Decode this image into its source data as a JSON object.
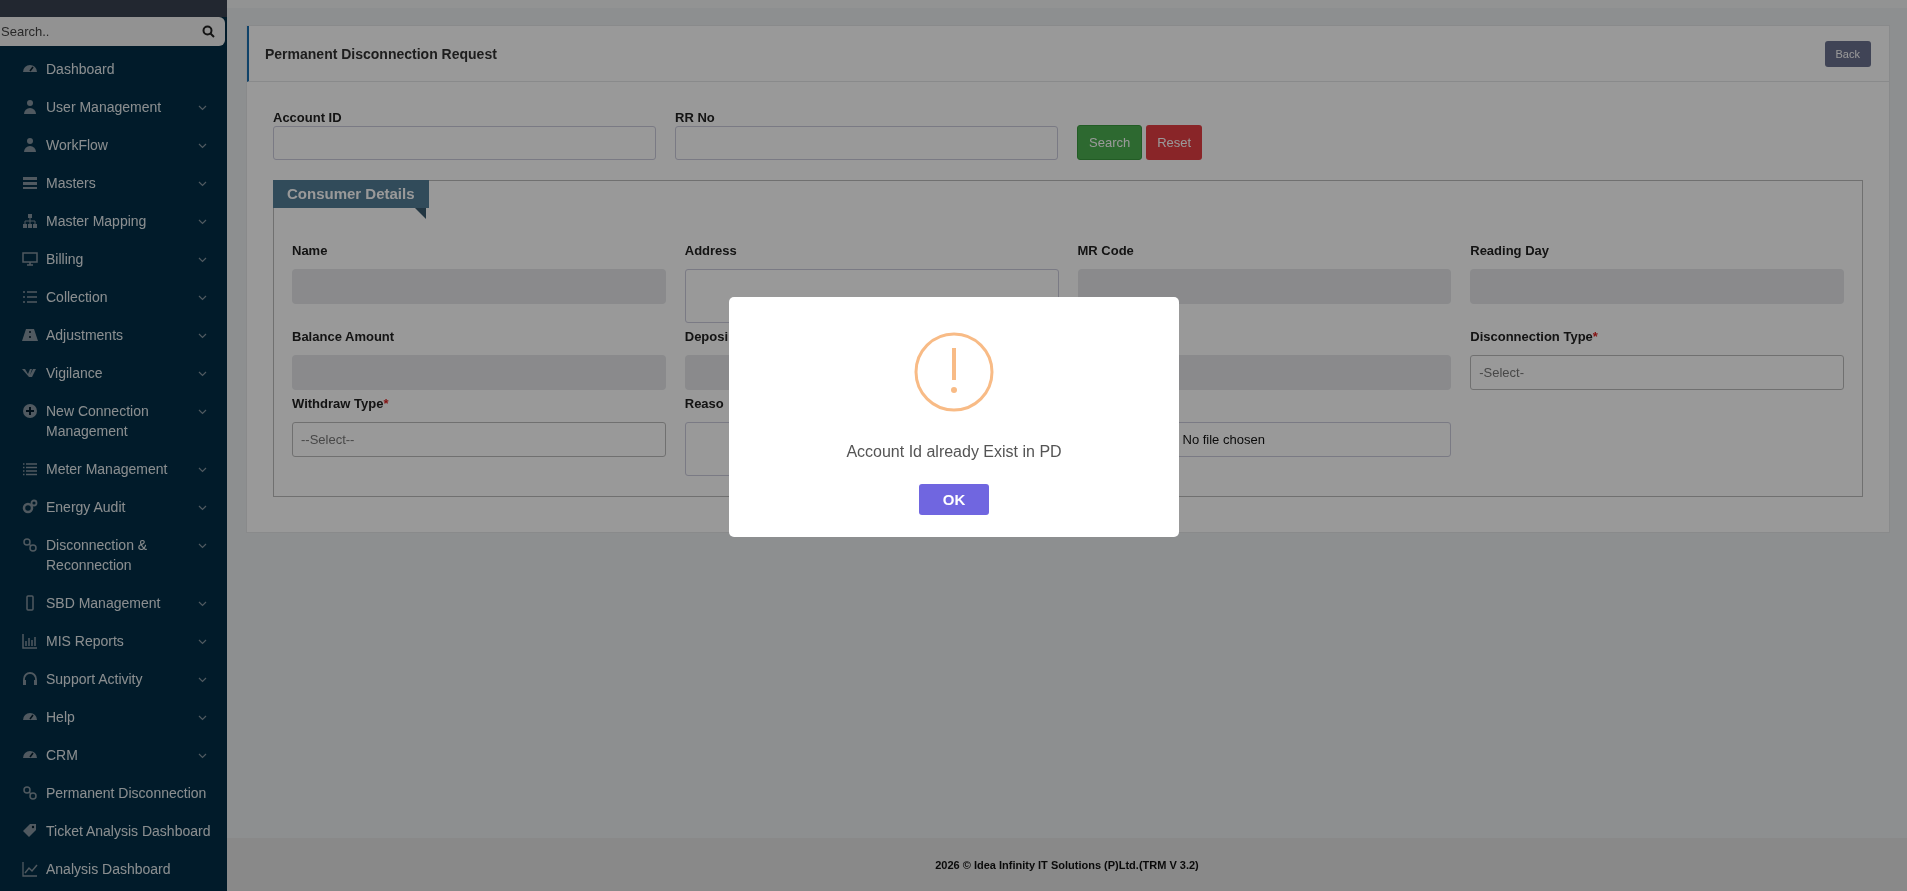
{
  "sidebar": {
    "search_placeholder": "Search..",
    "items": [
      {
        "label": "Dashboard",
        "has_submenu": false
      },
      {
        "label": "User Management",
        "has_submenu": true
      },
      {
        "label": "WorkFlow",
        "has_submenu": true
      },
      {
        "label": "Masters",
        "has_submenu": true
      },
      {
        "label": "Master Mapping",
        "has_submenu": true
      },
      {
        "label": "Billing",
        "has_submenu": true
      },
      {
        "label": "Collection",
        "has_submenu": true
      },
      {
        "label": "Adjustments",
        "has_submenu": true
      },
      {
        "label": "Vigilance",
        "has_submenu": true
      },
      {
        "label": "New Connection Management",
        "has_submenu": true
      },
      {
        "label": "Meter Management",
        "has_submenu": true
      },
      {
        "label": "Energy Audit",
        "has_submenu": true
      },
      {
        "label": "Disconnection & Reconnection",
        "has_submenu": true
      },
      {
        "label": "SBD Management",
        "has_submenu": true
      },
      {
        "label": "MIS Reports",
        "has_submenu": true
      },
      {
        "label": "Support Activity",
        "has_submenu": true
      },
      {
        "label": "Help",
        "has_submenu": true
      },
      {
        "label": "CRM",
        "has_submenu": true
      },
      {
        "label": "Permanent Disconnection",
        "has_submenu": false
      },
      {
        "label": "Ticket Analysis Dashboard",
        "has_submenu": false
      },
      {
        "label": "Analysis Dashboard",
        "has_submenu": false
      }
    ]
  },
  "page": {
    "title": "Permanent Disconnection Request",
    "back_button": "Back",
    "search_form": {
      "fields": [
        {
          "label": "Account ID"
        },
        {
          "label": "RR No"
        }
      ],
      "buttons": [
        {
          "label": "Search",
          "kind": "success"
        },
        {
          "label": "Reset",
          "kind": "danger"
        }
      ]
    },
    "consumer_details": {
      "title": "Consumer Details",
      "fields": [
        {
          "label": "Name",
          "kind": "readonly"
        },
        {
          "label": "Address",
          "kind": "textarea"
        },
        {
          "label": "MR Code",
          "kind": "readonly"
        },
        {
          "label": "Reading Day",
          "kind": "readonly"
        },
        {
          "label": "Balance Amount",
          "kind": "readonly"
        },
        {
          "label": "Deposi",
          "kind": "readonly"
        },
        {
          "kind": "readonly"
        },
        {
          "label": "Disconnection Type",
          "required_mark": "*",
          "kind": "select",
          "placeholder": "-Select-"
        },
        {
          "label": "Withdraw Type",
          "required_mark": "*",
          "kind": "select",
          "placeholder": "--Select--"
        },
        {
          "label": "Reaso",
          "kind": "textarea"
        },
        {
          "kind": "file",
          "value": "No file chosen"
        }
      ]
    }
  },
  "footer": "2026 © Idea Infinity IT Solutions (P)Ltd.(TRM V 3.2)",
  "dialog": {
    "message": "Account Id already Exist in PD",
    "button": "OK"
  }
}
